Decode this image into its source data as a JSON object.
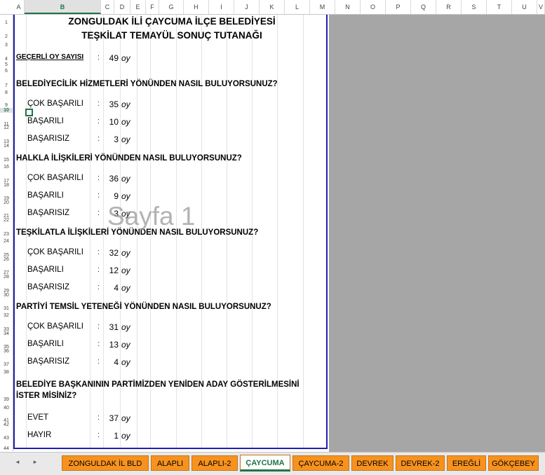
{
  "columns": [
    "A",
    "B",
    "C",
    "D",
    "E",
    "F",
    "G",
    "H",
    "I",
    "J",
    "K",
    "L",
    "M",
    "N",
    "O",
    "P",
    "Q",
    "R",
    "S",
    "T",
    "U",
    "V"
  ],
  "rows": [
    "1",
    "2",
    "3",
    "4",
    "5",
    "6",
    "7",
    "8",
    "9",
    "10",
    "11",
    "12",
    "13",
    "14",
    "15",
    "16",
    "17",
    "18",
    "19",
    "20",
    "21",
    "22",
    "23",
    "24",
    "25",
    "26",
    "27",
    "28",
    "29",
    "30",
    "31",
    "32",
    "33",
    "34",
    "35",
    "36",
    "37",
    "38",
    "39",
    "40",
    "41",
    "42",
    "43",
    "44"
  ],
  "title_line1": "ZONGULDAK İLİ ÇAYCUMA İLÇE BELEDİYESİ",
  "title_line2": "TEŞKİLAT TEMAYÜL SONUÇ TUTANAĞI",
  "valid_votes": {
    "label": "GEÇERLİ OY SAYISI",
    "colon": ":",
    "value": "49",
    "unit": "oy"
  },
  "questions": [
    {
      "text": "BELEDİYECİLİK HİZMETLERİ YÖNÜNDEN NASIL BULUYORSUNUZ?",
      "options": [
        {
          "label": "ÇOK BAŞARILI",
          "colon": ":",
          "value": "35",
          "unit": "oy"
        },
        {
          "label": "BAŞARILI",
          "colon": ":",
          "value": "10",
          "unit": "oy"
        },
        {
          "label": "BAŞARISIZ",
          "colon": ":",
          "value": "3",
          "unit": "oy"
        }
      ]
    },
    {
      "text": "HALKLA İLİŞKİLERİ YÖNÜNDEN NASIL BULUYORSUNUZ?",
      "options": [
        {
          "label": "ÇOK BAŞARILI",
          "colon": ":",
          "value": "36",
          "unit": "oy"
        },
        {
          "label": "BAŞARILI",
          "colon": ":",
          "value": "9",
          "unit": "oy"
        },
        {
          "label": "BAŞARISIZ",
          "colon": ":",
          "value": "3",
          "unit": "oy"
        }
      ]
    },
    {
      "text": "TEŞKİLATLA İLİŞKİLERİ YÖNÜNDEN NASIL BULUYORSUNUZ?",
      "options": [
        {
          "label": "ÇOK BAŞARILI",
          "colon": ":",
          "value": "32",
          "unit": "oy"
        },
        {
          "label": "BAŞARILI",
          "colon": ":",
          "value": "12",
          "unit": "oy"
        },
        {
          "label": "BAŞARISIZ",
          "colon": ":",
          "value": "4",
          "unit": "oy"
        }
      ]
    },
    {
      "text": "PARTİYİ TEMSİL YETENEĞİ YÖNÜNDEN NASIL BULUYORSUNUZ?",
      "options": [
        {
          "label": "ÇOK BAŞARILI",
          "colon": ":",
          "value": "31",
          "unit": "oy"
        },
        {
          "label": "BAŞARILI",
          "colon": ":",
          "value": "13",
          "unit": "oy"
        },
        {
          "label": "BAŞARISIZ",
          "colon": ":",
          "value": "4",
          "unit": "oy"
        }
      ]
    }
  ],
  "last_question": {
    "line1": "BELEDİYE BAŞKANININ PARTİMİZDEN YENİDEN ADAY GÖSTERİLMESİNİ",
    "line2": "İSTER MİSİNİZ?",
    "options": [
      {
        "label": "EVET",
        "colon": ":",
        "value": "37",
        "unit": "oy"
      },
      {
        "label": "HAYIR",
        "colon": ":",
        "value": "1",
        "unit": "oy"
      }
    ]
  },
  "watermark": "Sayfa 1",
  "nav": {
    "prev": "◂",
    "next": "▸"
  },
  "tabs": [
    "ZONGULDAK İL BLD",
    "ALAPLI",
    "ALAPLI-2",
    "ÇAYCUMA",
    "ÇAYCUMA-2",
    "DEVREK",
    "DEVREK-2",
    "EREĞLİ",
    "GÖKÇEBEY"
  ],
  "active_tab": "ÇAYCUMA",
  "selected_cell": "B10",
  "colors": {
    "tab": "#f7921e",
    "active_tab_text": "#217346",
    "page_border": "#1f1fb0",
    "gray_area": "#a6a6a6"
  }
}
